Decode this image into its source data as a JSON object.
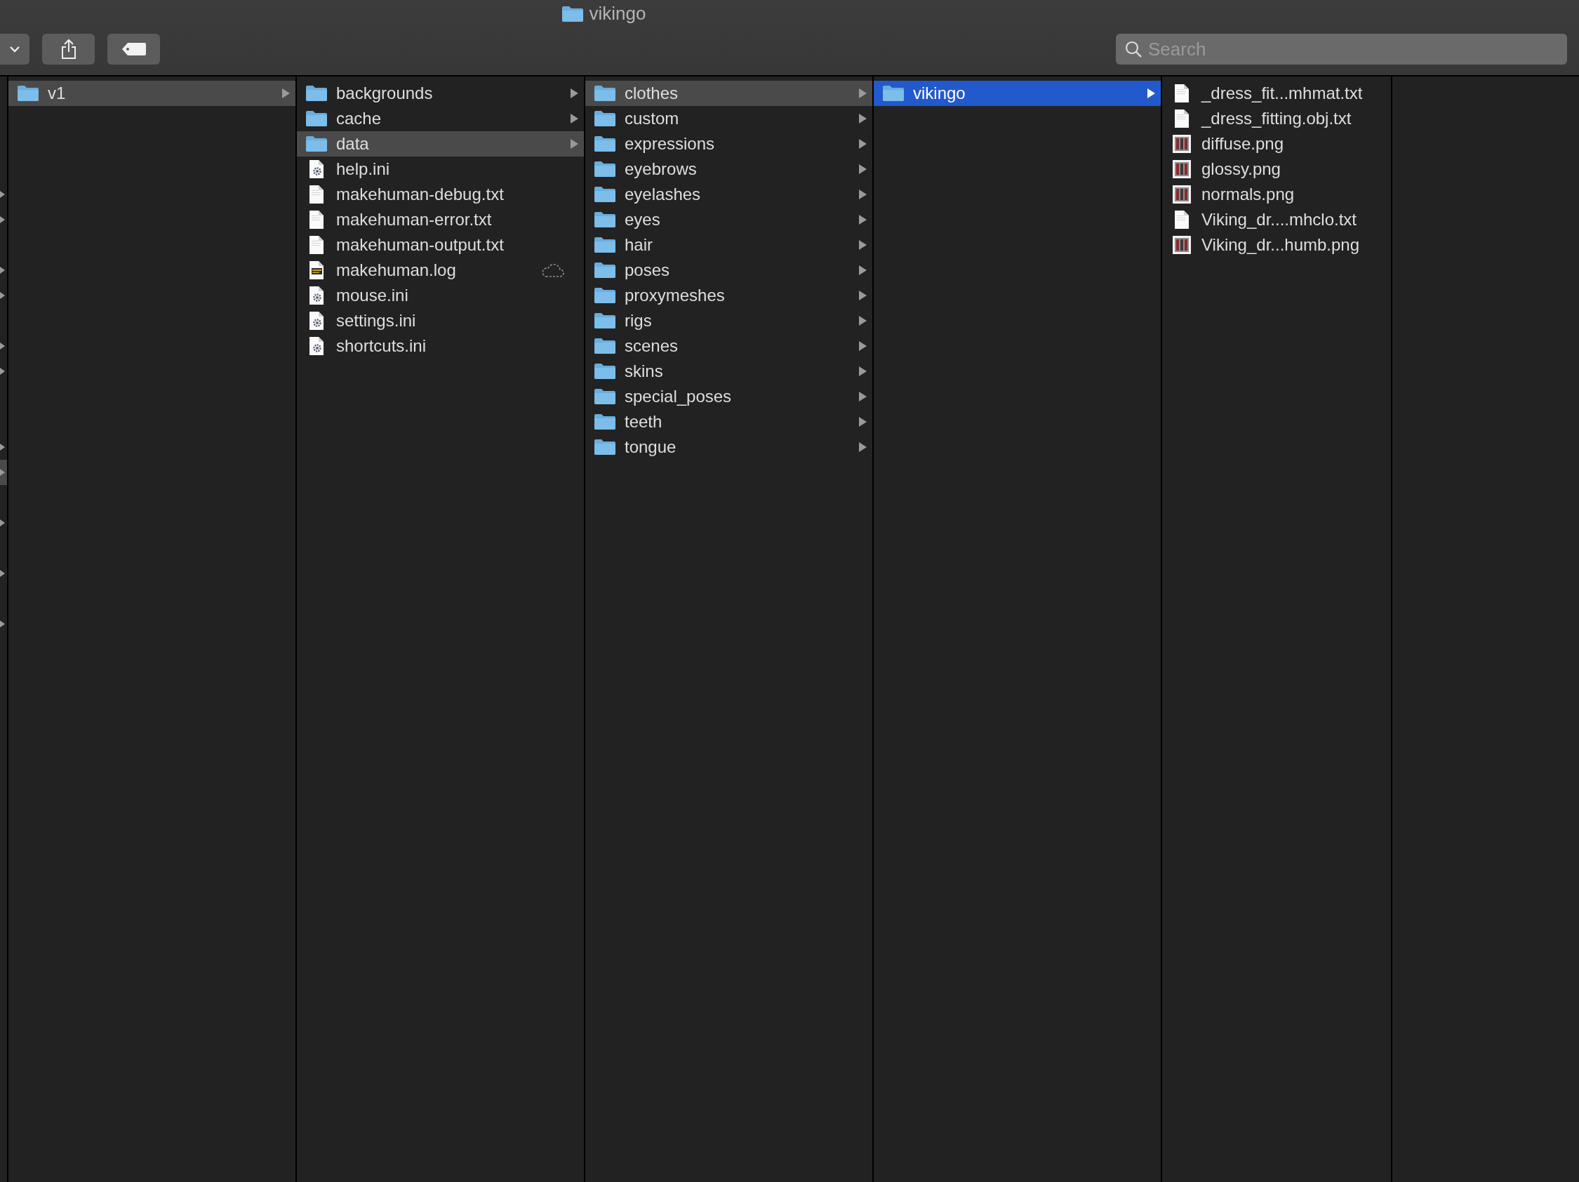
{
  "window": {
    "title": "vikingo"
  },
  "toolbar": {
    "search": {
      "placeholder": "Search"
    }
  },
  "edge_column": {
    "rows": [
      {
        "selected": false
      },
      {
        "selected": false
      },
      {
        "selected": false
      },
      {
        "selected": false
      },
      {
        "selected": false
      },
      {
        "selected": false
      },
      {
        "selected": false
      },
      {
        "selected": true
      },
      {
        "selected": false
      },
      {
        "selected": false
      },
      {
        "selected": false
      }
    ]
  },
  "columns": [
    {
      "items": [
        {
          "name": "v1",
          "kind": "folder",
          "selected": true
        }
      ]
    },
    {
      "items": [
        {
          "name": "backgrounds",
          "kind": "folder",
          "selected": false
        },
        {
          "name": "cache",
          "kind": "folder",
          "selected": false
        },
        {
          "name": "data",
          "kind": "folder",
          "selected": true
        },
        {
          "name": "help.ini",
          "kind": "settings",
          "selected": false
        },
        {
          "name": "makehuman-debug.txt",
          "kind": "text",
          "selected": false
        },
        {
          "name": "makehuman-error.txt",
          "kind": "text",
          "selected": false
        },
        {
          "name": "makehuman-output.txt",
          "kind": "text",
          "selected": false
        },
        {
          "name": "makehuman.log",
          "kind": "log",
          "selected": false,
          "cloud": true
        },
        {
          "name": "mouse.ini",
          "kind": "settings",
          "selected": false
        },
        {
          "name": "settings.ini",
          "kind": "settings",
          "selected": false
        },
        {
          "name": "shortcuts.ini",
          "kind": "settings",
          "selected": false
        }
      ]
    },
    {
      "items": [
        {
          "name": "clothes",
          "kind": "folder",
          "selected": true
        },
        {
          "name": "custom",
          "kind": "folder",
          "selected": false
        },
        {
          "name": "expressions",
          "kind": "folder",
          "selected": false
        },
        {
          "name": "eyebrows",
          "kind": "folder",
          "selected": false
        },
        {
          "name": "eyelashes",
          "kind": "folder",
          "selected": false
        },
        {
          "name": "eyes",
          "kind": "folder",
          "selected": false
        },
        {
          "name": "hair",
          "kind": "folder",
          "selected": false
        },
        {
          "name": "poses",
          "kind": "folder",
          "selected": false
        },
        {
          "name": "proxymeshes",
          "kind": "folder",
          "selected": false
        },
        {
          "name": "rigs",
          "kind": "folder",
          "selected": false
        },
        {
          "name": "scenes",
          "kind": "folder",
          "selected": false
        },
        {
          "name": "skins",
          "kind": "folder",
          "selected": false
        },
        {
          "name": "special_poses",
          "kind": "folder",
          "selected": false
        },
        {
          "name": "teeth",
          "kind": "folder",
          "selected": false
        },
        {
          "name": "tongue",
          "kind": "folder",
          "selected": false
        }
      ]
    },
    {
      "items": [
        {
          "name": "vikingo",
          "kind": "folder",
          "selected": true
        }
      ]
    },
    {
      "items": [
        {
          "name": "_dress_fit...mhmat.txt",
          "kind": "text",
          "selected": false
        },
        {
          "name": "_dress_fitting.obj.txt",
          "kind": "text",
          "selected": false
        },
        {
          "name": "diffuse.png",
          "kind": "image",
          "selected": false
        },
        {
          "name": "glossy.png",
          "kind": "image",
          "selected": false
        },
        {
          "name": "normals.png",
          "kind": "image",
          "selected": false
        },
        {
          "name": "Viking_dr....mhclo.txt",
          "kind": "text",
          "selected": false
        },
        {
          "name": "Viking_dr...humb.png",
          "kind": "image",
          "selected": false
        }
      ]
    }
  ]
}
